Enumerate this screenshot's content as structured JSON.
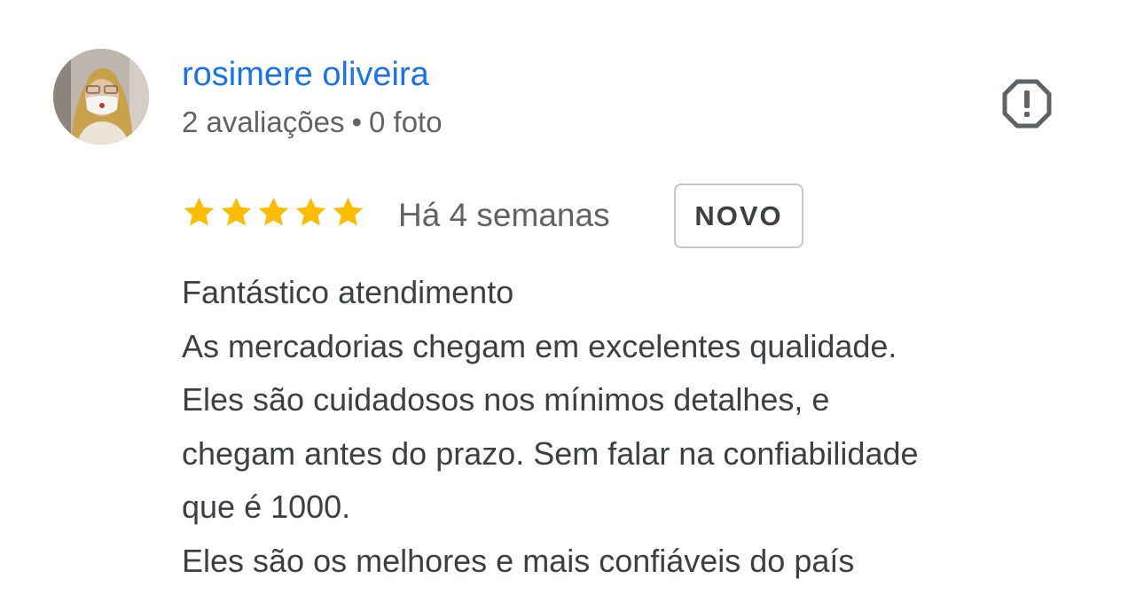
{
  "review": {
    "author": {
      "name": "rosimere oliveira",
      "reviews_count": "2 avaliações",
      "separator": "•",
      "photos_count": "0 foto"
    },
    "flag_icon": "report-flag-icon",
    "rating": 5,
    "max_rating": 5,
    "star_color": "#fbbc04",
    "time_ago": "Há 4 semanas",
    "badge": "NOVO",
    "text_lines": [
      "Fantástico atendimento",
      "As mercadorias chegam em excelentes qualidade.",
      "Eles são cuidadosos nos mínimos detalhes, e",
      "chegam antes do prazo. Sem falar na confiabilidade",
      "que é 1000.",
      "Eles são os melhores e mais confiáveis do país"
    ]
  },
  "colors": {
    "name": "#1a73e8",
    "secondary_text": "#5f6368",
    "body_text": "#3c4043",
    "badge_border": "#c4c7c5"
  }
}
